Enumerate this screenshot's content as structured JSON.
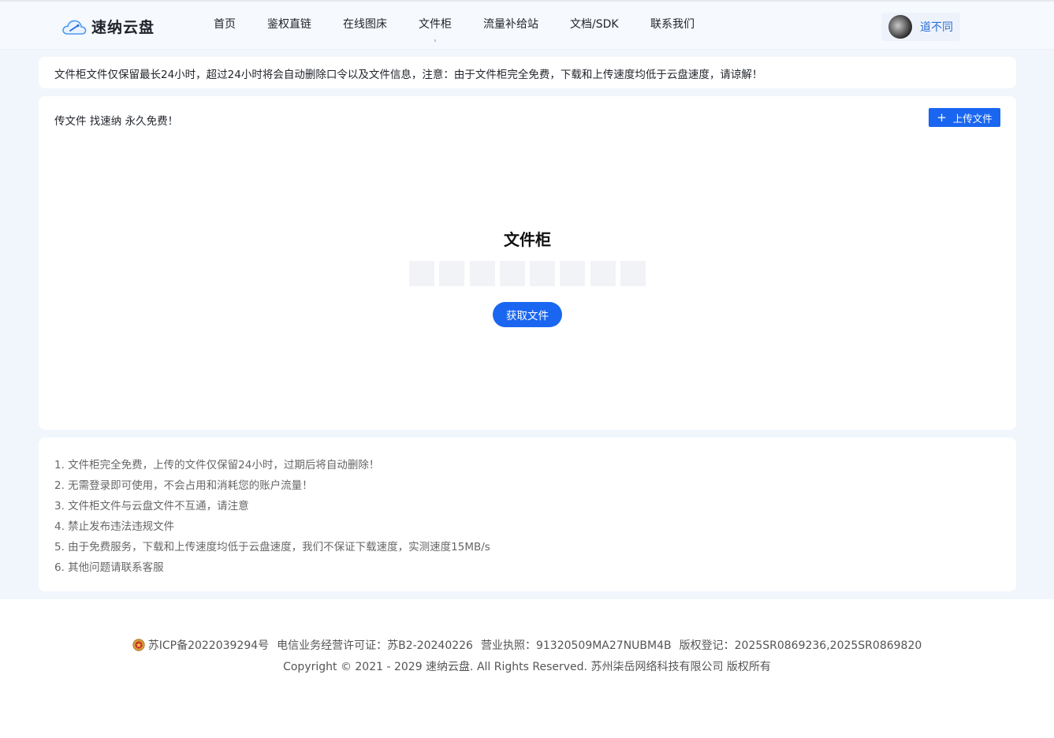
{
  "header": {
    "logo_text": "速纳云盘",
    "nav": [
      {
        "label": "首页"
      },
      {
        "label": "鉴权直链"
      },
      {
        "label": "在线图床"
      },
      {
        "label": "文件柜"
      },
      {
        "label": "流量补给站"
      },
      {
        "label": "文档/SDK"
      },
      {
        "label": "联系我们"
      }
    ],
    "active_nav": "文件柜",
    "username": "道不同"
  },
  "notice": {
    "text": "文件柜文件仅保留最长24小时，超过24小时将会自动删除口令以及文件信息，注意：由于文件柜完全免费，下载和上传速度均低于云盘速度，请谅解！"
  },
  "locker": {
    "slogan": "传文件 找速纳 永久免费！",
    "upload_label": "上传文件",
    "title": "文件柜",
    "code_length": 8,
    "get_label": "获取文件"
  },
  "rules": [
    "1. 文件柜完全免费，上传的文件仅保留24小时，过期后将自动删除！",
    "2. 无需登录即可使用，不会占用和消耗您的账户流量！",
    "3. 文件柜文件与云盘文件不互通，请注意",
    "4. 禁止发布违法违规文件",
    "5. 由于免费服务，下载和上传速度均低于云盘速度，我们不保证下载速度，实测速度15MB/s",
    "6. 其他问题请联系客服"
  ],
  "footer": {
    "icp": "苏ICP备2022039294号",
    "telecom": "电信业务经营许可证：苏B2-20240226",
    "license": "营业执照：91320509MA27NUBM4B",
    "copyright_reg": "版权登记：2025SR0869236,2025SR0869820",
    "copyright": "Copyright © 2021 - 2029 速纳云盘. All Rights Reserved. 苏州柒岳网络科技有限公司 版权所有"
  },
  "colors": {
    "accent": "#1a66f0",
    "page_bg": "#f1f6fd",
    "username": "#2b6fd6"
  }
}
